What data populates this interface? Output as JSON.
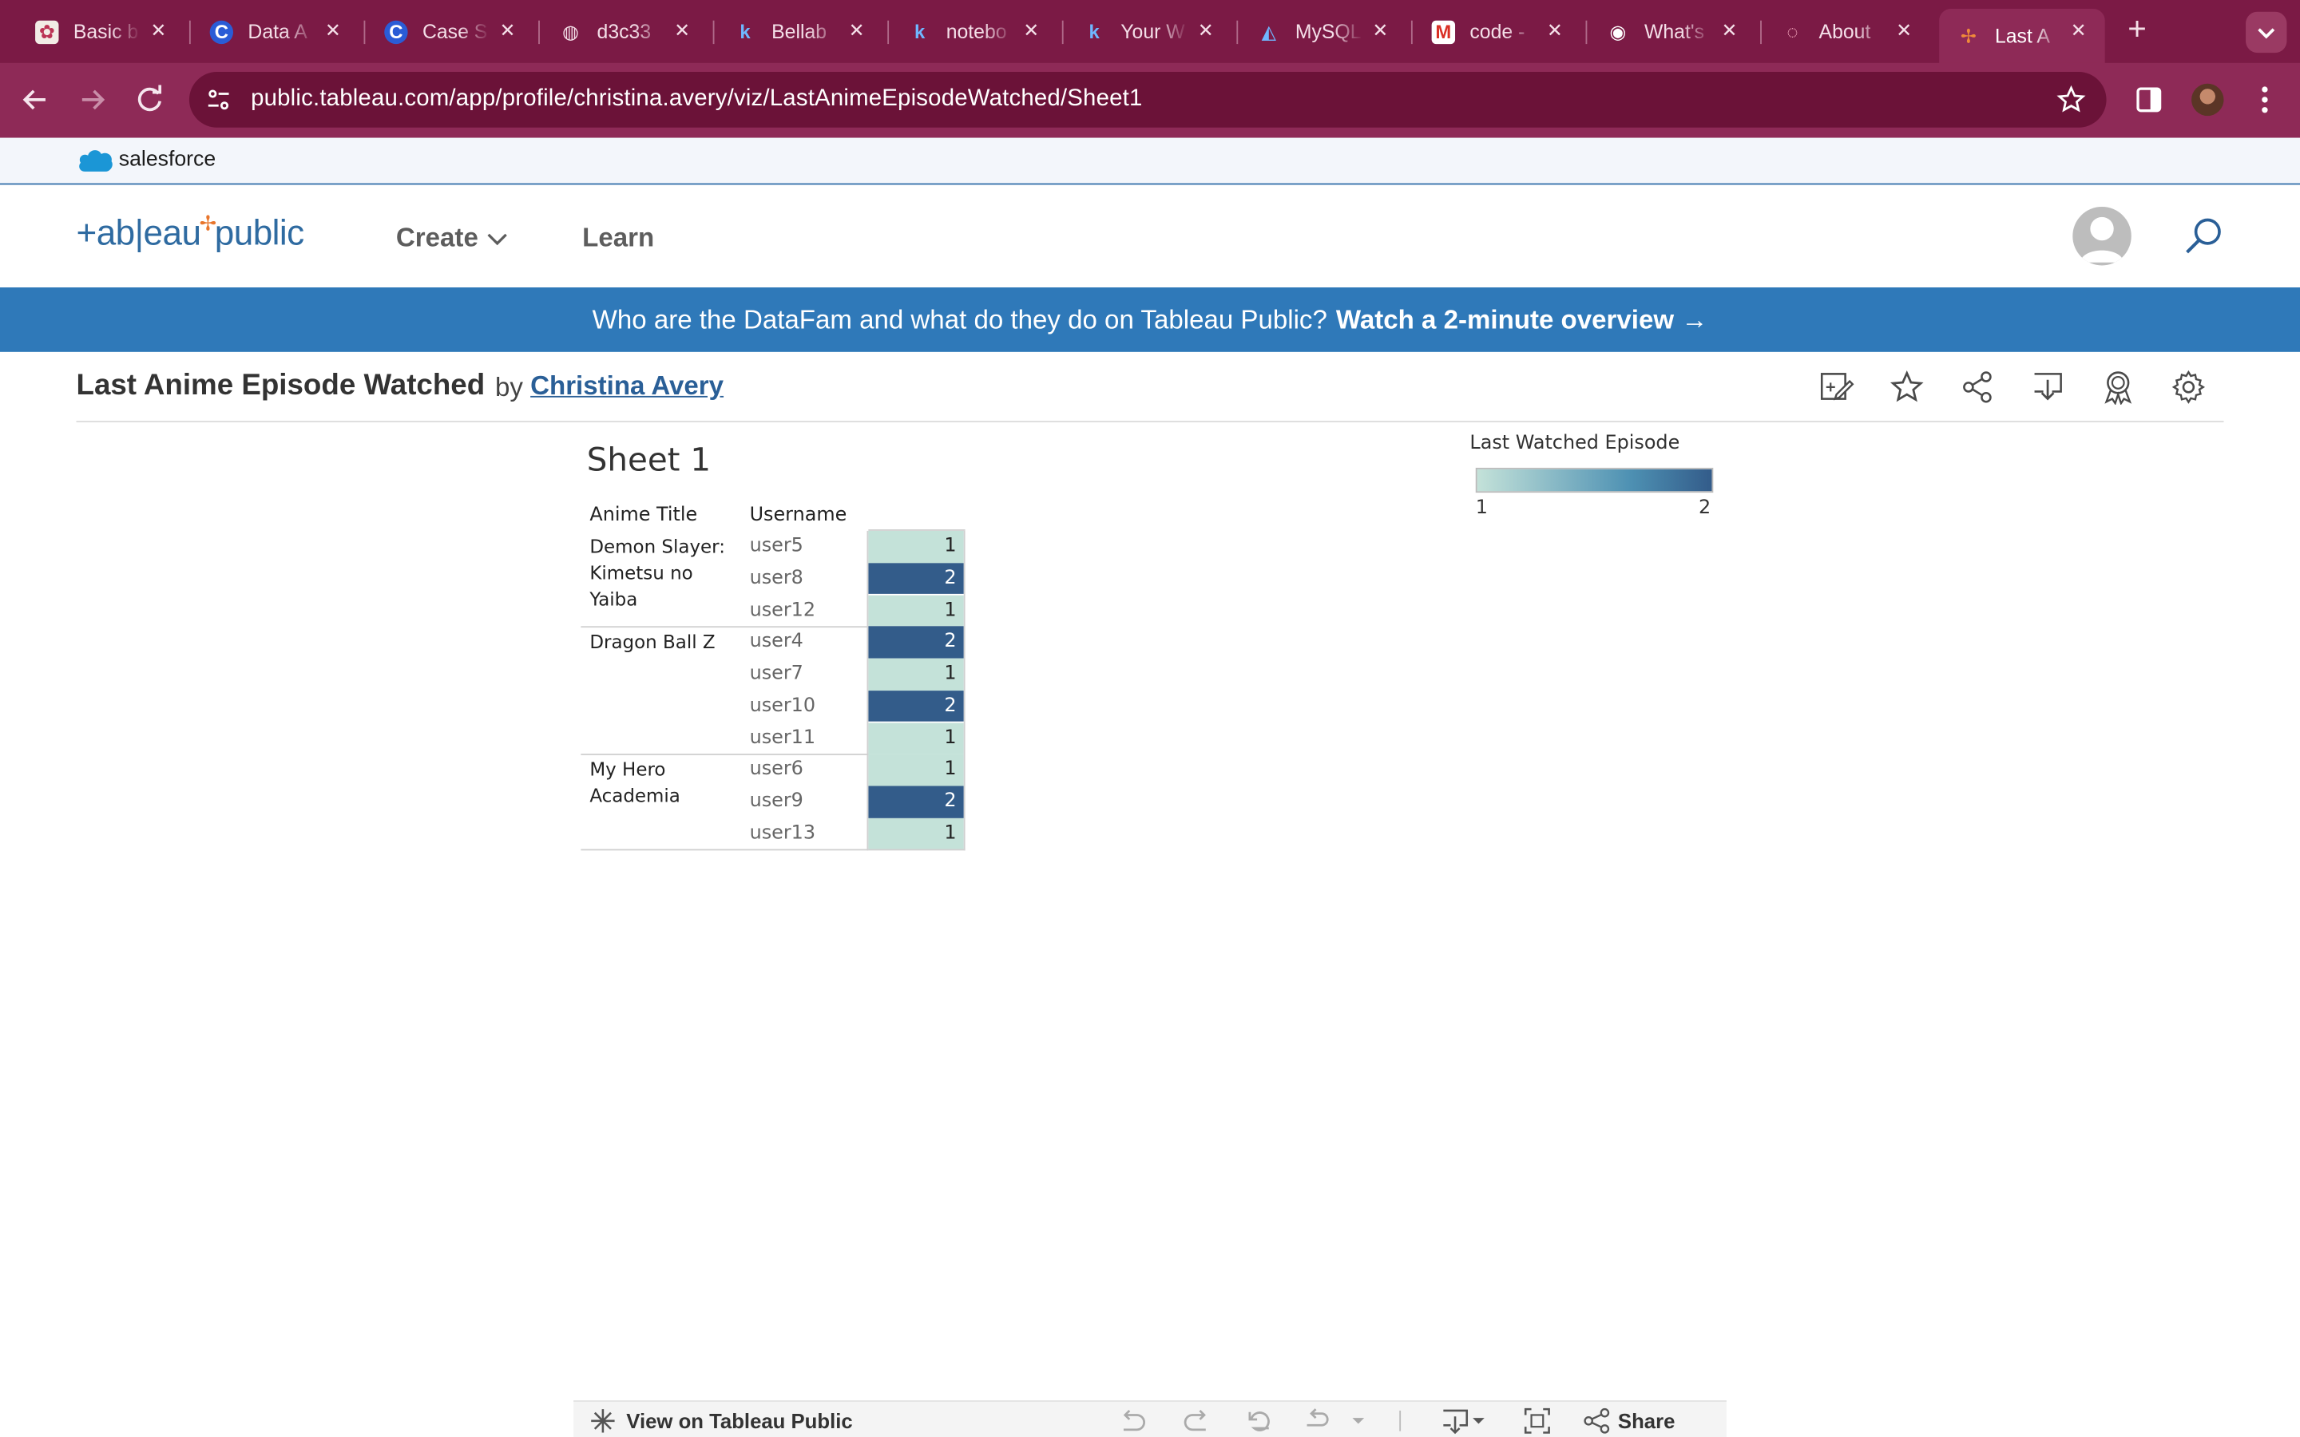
{
  "browser": {
    "tabs": [
      {
        "title": "Basic b",
        "icon": "paper-doc-icon"
      },
      {
        "title": "Data A",
        "icon": "c-brand-icon"
      },
      {
        "title": "Case S",
        "icon": "c-brand-icon"
      },
      {
        "title": "d3c33",
        "icon": "globe-icon"
      },
      {
        "title": "Bellab",
        "icon": "k-brand-icon"
      },
      {
        "title": "notebo",
        "icon": "k-brand-icon"
      },
      {
        "title": "Your W",
        "icon": "k-brand-icon"
      },
      {
        "title": "MySQL",
        "icon": "mysql-dolphin-icon"
      },
      {
        "title": "code -",
        "icon": "gmail-icon"
      },
      {
        "title": "What's",
        "icon": "chrome-icon"
      },
      {
        "title": "About",
        "icon": "copilot-icon"
      },
      {
        "title": "Last A",
        "icon": "tableau-icon"
      }
    ],
    "url": "public.tableau.com/app/profile/christina.avery/viz/LastAnimeEpisodeWatched/Sheet1"
  },
  "salesforce": {
    "label": "salesforce"
  },
  "header": {
    "logo_left": "+ab|eau",
    "logo_right": "public",
    "nav_create": "Create",
    "nav_learn": "Learn"
  },
  "banner": {
    "text": "Who are the DataFam and what do they do on Tableau Public?",
    "link": "Watch a 2-minute overview →"
  },
  "viz": {
    "title": "Last Anime Episode Watched",
    "by": "by",
    "author": "Christina Avery"
  },
  "worksheet": {
    "sheet_title": "Sheet 1",
    "col_anime": "Anime Title",
    "col_user": "Username",
    "groups": [
      {
        "title": "Demon Slayer: Kimetsu no Yaiba",
        "rows": [
          {
            "user": "user5",
            "value": 1
          },
          {
            "user": "user8",
            "value": 2
          },
          {
            "user": "user12",
            "value": 1
          }
        ]
      },
      {
        "title": "Dragon Ball Z",
        "rows": [
          {
            "user": "user4",
            "value": 2
          },
          {
            "user": "user7",
            "value": 1
          },
          {
            "user": "user10",
            "value": 2
          },
          {
            "user": "user11",
            "value": 1
          }
        ]
      },
      {
        "title": "My Hero Academia",
        "rows": [
          {
            "user": "user6",
            "value": 1
          },
          {
            "user": "user9",
            "value": 2
          },
          {
            "user": "user13",
            "value": 1
          }
        ]
      }
    ],
    "legend": {
      "title": "Last Watched Episode",
      "min": "1",
      "max": "2"
    },
    "colors": {
      "low": "#c4e2d9",
      "high": "#335c8a",
      "mid": "#4e91b3"
    }
  },
  "viz_toolbar": {
    "view_link": "View on Tableau Public",
    "share": "Share"
  }
}
